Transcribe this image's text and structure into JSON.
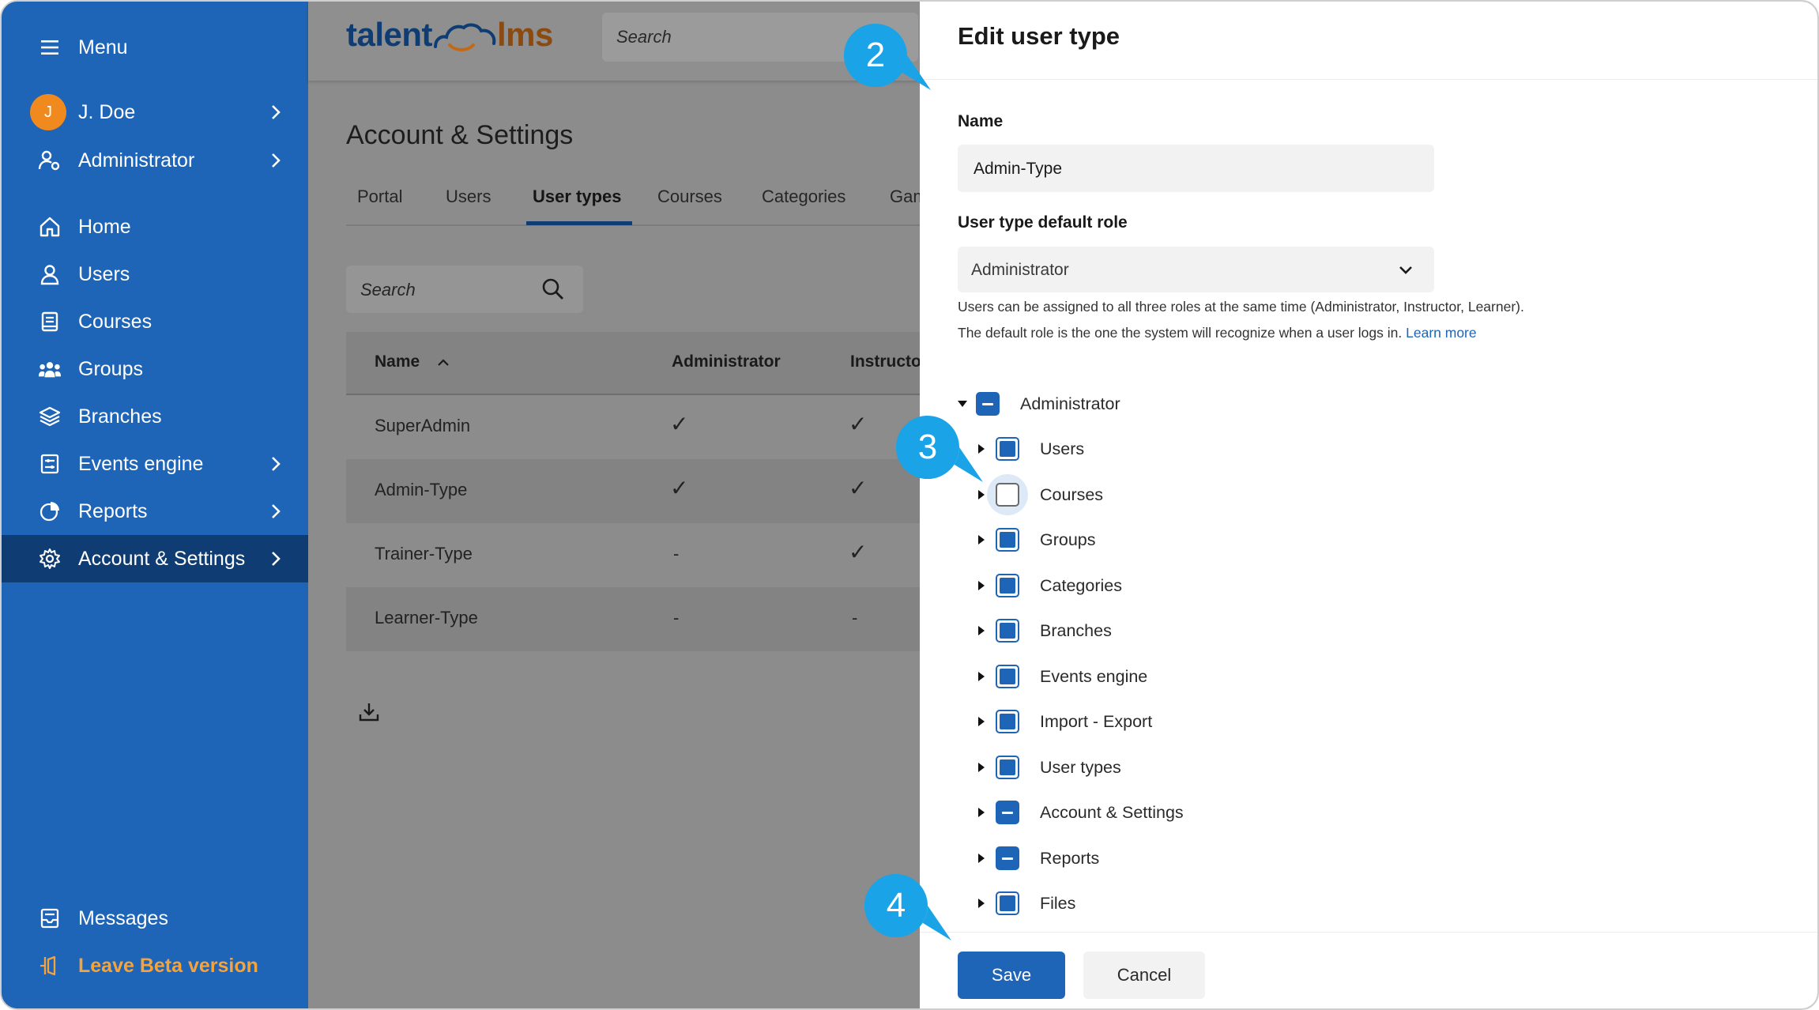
{
  "sidebar": {
    "menu_label": "Menu",
    "user": {
      "initial": "J",
      "name": "J. Doe"
    },
    "role_label": "Administrator",
    "nav": [
      {
        "label": "Home"
      },
      {
        "label": "Users"
      },
      {
        "label": "Courses"
      },
      {
        "label": "Groups"
      },
      {
        "label": "Branches"
      },
      {
        "label": "Events engine"
      },
      {
        "label": "Reports"
      },
      {
        "label": "Account & Settings"
      }
    ],
    "messages_label": "Messages",
    "leave_beta_label": "Leave Beta version"
  },
  "header": {
    "logo_left": "talent",
    "logo_right": "lms",
    "search_placeholder": "Search"
  },
  "main": {
    "title": "Account & Settings",
    "tabs": [
      "Portal",
      "Users",
      "User types",
      "Courses",
      "Categories",
      "Gam"
    ],
    "active_tab": "User types",
    "search_placeholder": "Search",
    "columns": [
      "Name",
      "Administrator",
      "Instructo"
    ],
    "rows": [
      {
        "name": "SuperAdmin",
        "admin": "✓",
        "instructor": "✓"
      },
      {
        "name": "Admin-Type",
        "admin": "✓",
        "instructor": "✓"
      },
      {
        "name": "Trainer-Type",
        "admin": "-",
        "instructor": "✓"
      },
      {
        "name": "Learner-Type",
        "admin": "-",
        "instructor": "-"
      }
    ]
  },
  "panel": {
    "title": "Edit user type",
    "name_label": "Name",
    "name_value": "Admin-Type",
    "role_label": "User type default role",
    "role_value": "Administrator",
    "help_line1": "Users can be assigned to all three roles at the same time (Administrator, Instructor, Learner).",
    "help_line2": "The default role is the one the system will recognize when a user logs in.",
    "learn_more": "Learn more",
    "tree_root": {
      "label": "Administrator",
      "state": "partial"
    },
    "tree_items": [
      {
        "label": "Users",
        "state": "checked"
      },
      {
        "label": "Courses",
        "state": "unchecked"
      },
      {
        "label": "Groups",
        "state": "checked"
      },
      {
        "label": "Categories",
        "state": "checked"
      },
      {
        "label": "Branches",
        "state": "checked"
      },
      {
        "label": "Events engine",
        "state": "checked"
      },
      {
        "label": "Import - Export",
        "state": "checked"
      },
      {
        "label": "User types",
        "state": "checked"
      },
      {
        "label": "Account & Settings",
        "state": "partial"
      },
      {
        "label": "Reports",
        "state": "partial"
      },
      {
        "label": "Files",
        "state": "checked"
      }
    ],
    "save_label": "Save",
    "cancel_label": "Cancel"
  },
  "callouts": [
    "2",
    "3",
    "4"
  ],
  "colors": {
    "brand_blue": "#1e64b7",
    "sidebar_active": "#0f3d73",
    "accent_orange": "#f08a1e",
    "callout_blue": "#1aa3e6"
  }
}
